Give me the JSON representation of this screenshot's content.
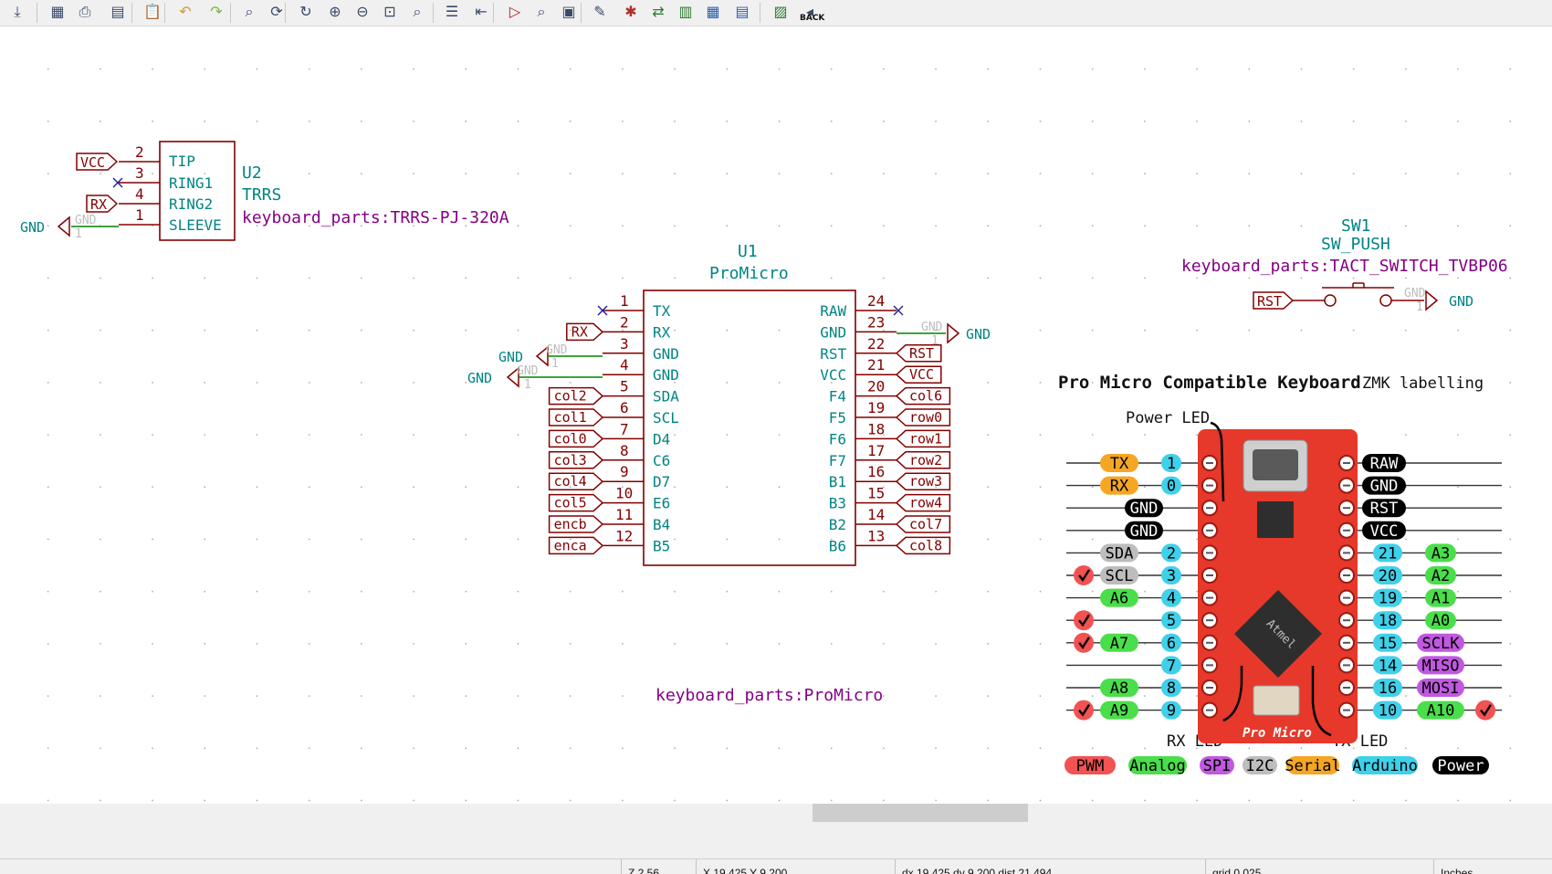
{
  "toolbar": {
    "icons": [
      "save-icon",
      "page-settings-icon",
      "print-icon",
      "plot-icon",
      "paste-icon",
      "undo-icon",
      "redo-icon",
      "find-icon",
      "find-replace-icon",
      "refresh-icon",
      "zoom-in-icon",
      "zoom-out-icon",
      "zoom-fit-icon",
      "zoom-selection-icon",
      "hierarchy-icon",
      "leave-sheet-icon",
      "place-symbol-icon",
      "inspect-icon",
      "annotate-icon",
      "edit-fields-icon",
      "erc-icon",
      "assign-footprints-icon",
      "netlist-icon",
      "bom-table-icon",
      "bom-icon",
      "pcb-icon",
      "back-icon"
    ],
    "back_label": "BACK"
  },
  "schematic": {
    "u2": {
      "ref": "U2",
      "value": "TRRS",
      "footprint": "keyboard_parts:TRRS-PJ-320A",
      "pins": [
        {
          "num": "2",
          "name": "TIP"
        },
        {
          "num": "3",
          "name": "RING1"
        },
        {
          "num": "4",
          "name": "RING2"
        },
        {
          "num": "1",
          "name": "SLEEVE"
        }
      ],
      "labels": {
        "vcc": "VCC",
        "rx": "RX",
        "gnd": "GND",
        "ghost_gnd": "GND",
        "ghost_one": "1"
      }
    },
    "u1": {
      "ref": "U1",
      "value": "ProMicro",
      "footprint": "keyboard_parts:ProMicro",
      "left_pins": [
        {
          "num": "1",
          "name": "TX",
          "net": ""
        },
        {
          "num": "2",
          "name": "RX",
          "net": "RX"
        },
        {
          "num": "3",
          "name": "GND",
          "net": ""
        },
        {
          "num": "4",
          "name": "GND",
          "net": ""
        },
        {
          "num": "5",
          "name": "SDA",
          "net": "col2"
        },
        {
          "num": "6",
          "name": "SCL",
          "net": "col1"
        },
        {
          "num": "7",
          "name": "D4",
          "net": "col0"
        },
        {
          "num": "8",
          "name": "C6",
          "net": "col3"
        },
        {
          "num": "9",
          "name": "D7",
          "net": "col4"
        },
        {
          "num": "10",
          "name": "E6",
          "net": "col5"
        },
        {
          "num": "11",
          "name": "B4",
          "net": "encb"
        },
        {
          "num": "12",
          "name": "B5",
          "net": "enca"
        }
      ],
      "right_pins": [
        {
          "num": "24",
          "name": "RAW",
          "net": ""
        },
        {
          "num": "23",
          "name": "GND",
          "net": ""
        },
        {
          "num": "22",
          "name": "RST",
          "net": "RST"
        },
        {
          "num": "21",
          "name": "VCC",
          "net": "VCC"
        },
        {
          "num": "20",
          "name": "F4",
          "net": "col6"
        },
        {
          "num": "19",
          "name": "F5",
          "net": "row0"
        },
        {
          "num": "18",
          "name": "F6",
          "net": "row1"
        },
        {
          "num": "17",
          "name": "F7",
          "net": "row2"
        },
        {
          "num": "16",
          "name": "B1",
          "net": "row3"
        },
        {
          "num": "15",
          "name": "B3",
          "net": "row4"
        },
        {
          "num": "14",
          "name": "B2",
          "net": "col7"
        },
        {
          "num": "13",
          "name": "B6",
          "net": "col8"
        }
      ],
      "gnd_label": "GND",
      "ghost_gnd": "GND",
      "ghost_one": "1"
    },
    "sw1": {
      "ref": "SW1",
      "value": "SW_PUSH",
      "footprint": "keyboard_parts:TACT_SWITCH_TVBP06",
      "rst_label": "RST",
      "gnd_label": "GND",
      "ghost_gnd": "GND",
      "ghost_one": "1"
    }
  },
  "promicro_image": {
    "title": "Pro Micro Compatible Keyboard",
    "subtitle": "ZMK labelling",
    "power_led": "Power LED",
    "rx_led": "RX LED",
    "tx_led": "TX LED",
    "board_name": "Pro Micro",
    "chip_text": "Atmel",
    "left_rows": [
      {
        "check": false,
        "func": "TX",
        "func_color": "#f5a623",
        "num": "1"
      },
      {
        "check": false,
        "func": "RX",
        "func_color": "#f5a623",
        "num": "0"
      },
      {
        "check": false,
        "func": "GND",
        "func_color": "#000000",
        "num": ""
      },
      {
        "check": false,
        "func": "GND",
        "func_color": "#000000",
        "num": ""
      },
      {
        "check": false,
        "func": "SDA",
        "func_color": "#bdbdbd",
        "num": "2"
      },
      {
        "check": true,
        "func": "SCL",
        "func_color": "#bdbdbd",
        "num": "3"
      },
      {
        "check": false,
        "func": "A6",
        "func_color": "#4ade4a",
        "num": "4"
      },
      {
        "check": true,
        "func": "",
        "func_color": "",
        "num": "5"
      },
      {
        "check": true,
        "func": "A7",
        "func_color": "#4ade4a",
        "num": "6"
      },
      {
        "check": false,
        "func": "",
        "func_color": "",
        "num": "7"
      },
      {
        "check": false,
        "func": "A8",
        "func_color": "#4ade4a",
        "num": "8"
      },
      {
        "check": true,
        "func": "A9",
        "func_color": "#4ade4a",
        "num": "9"
      }
    ],
    "right_rows": [
      {
        "func": "RAW",
        "func_color": "#000000",
        "num": "",
        "alt": "",
        "alt_color": "",
        "check": false
      },
      {
        "func": "GND",
        "func_color": "#000000",
        "num": "",
        "alt": "",
        "alt_color": "",
        "check": false
      },
      {
        "func": "RST",
        "func_color": "#000000",
        "num": "",
        "alt": "",
        "alt_color": "",
        "check": false
      },
      {
        "func": "VCC",
        "func_color": "#000000",
        "num": "",
        "alt": "",
        "alt_color": "",
        "check": false
      },
      {
        "func": "",
        "func_color": "",
        "num": "21",
        "alt": "A3",
        "alt_color": "#4ade4a",
        "check": false
      },
      {
        "func": "",
        "func_color": "",
        "num": "20",
        "alt": "A2",
        "alt_color": "#4ade4a",
        "check": false
      },
      {
        "func": "",
        "func_color": "",
        "num": "19",
        "alt": "A1",
        "alt_color": "#4ade4a",
        "check": false
      },
      {
        "func": "",
        "func_color": "",
        "num": "18",
        "alt": "A0",
        "alt_color": "#4ade4a",
        "check": false
      },
      {
        "func": "",
        "func_color": "",
        "num": "15",
        "alt": "SCLK",
        "alt_color": "#c158e0",
        "check": false
      },
      {
        "func": "",
        "func_color": "",
        "num": "14",
        "alt": "MISO",
        "alt_color": "#c158e0",
        "check": false
      },
      {
        "func": "",
        "func_color": "",
        "num": "16",
        "alt": "MOSI",
        "alt_color": "#c158e0",
        "check": false
      },
      {
        "func": "",
        "func_color": "",
        "num": "10",
        "alt": "A10",
        "alt_color": "#4ade4a",
        "check": true
      }
    ],
    "legend": [
      {
        "text": "PWM",
        "color": "#f25252",
        "fg": "#000000"
      },
      {
        "text": "Analog",
        "color": "#4ade4a",
        "fg": "#000000"
      },
      {
        "text": "SPI",
        "color": "#c158e0",
        "fg": "#000000"
      },
      {
        "text": "I2C",
        "color": "#bdbdbd",
        "fg": "#000000"
      },
      {
        "text": "Serial",
        "color": "#f5a623",
        "fg": "#000000"
      },
      {
        "text": "Arduino",
        "color": "#3fd0ea",
        "fg": "#000000"
      },
      {
        "text": "Power",
        "color": "#000000",
        "fg": "#ffffff"
      }
    ]
  },
  "statusbar": {
    "zoom": "Z 2.56",
    "xy": "X 19.425  Y 9.200",
    "delta": "dx 19.425  dy 9.200  dist 21.494",
    "grid": "grid 0.025",
    "units": "Inches"
  }
}
